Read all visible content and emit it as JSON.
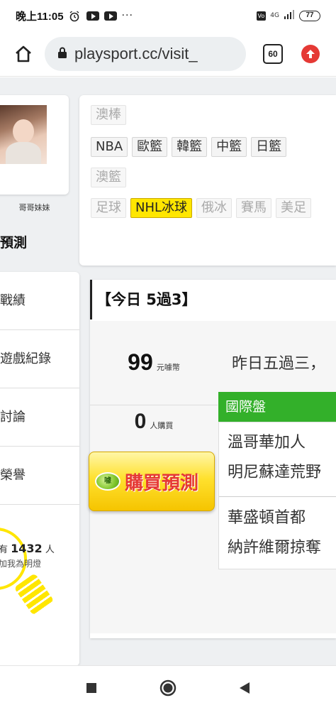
{
  "status_bar": {
    "time": "晚上11:05",
    "battery": "77",
    "network": "4G"
  },
  "browser": {
    "url": "playsport.cc/visit_",
    "tab_count": "60"
  },
  "profile": {
    "name": "哥哥妹妹"
  },
  "sports": {
    "row1": [
      "澳棒"
    ],
    "row2": [
      "NBA",
      "歐籃",
      "韓籃",
      "中籃",
      "日籃"
    ],
    "row3": [
      "澳籃"
    ],
    "row4": [
      "足球",
      "NHL冰球",
      "俄冰",
      "賽馬",
      "美足"
    ],
    "active": "NHL冰球"
  },
  "section": {
    "title": "預測"
  },
  "menu": {
    "items": [
      "戰績",
      "遊戲紀錄",
      "討論",
      "榮譽"
    ]
  },
  "fans": {
    "prefix": "有",
    "count": "1432",
    "suffix": "人",
    "line2": "加我為明燈"
  },
  "prediction": {
    "title": "【今日 5過3】",
    "price": "99",
    "price_unit": "元噱幣",
    "buyers": "0",
    "buyers_unit": "人購買",
    "yesterday": "昨日五過三，",
    "market": "國際盤",
    "games": [
      "溫哥華加人",
      "明尼蘇達荒野",
      "華盛頓首都",
      "納許維爾掠奪"
    ],
    "buy_label": "購買預測",
    "coin_label": "噱"
  },
  "colors": {
    "active_tag": "#ffe600",
    "market_green": "#33b02a",
    "buy_text_red": "#e53935"
  }
}
